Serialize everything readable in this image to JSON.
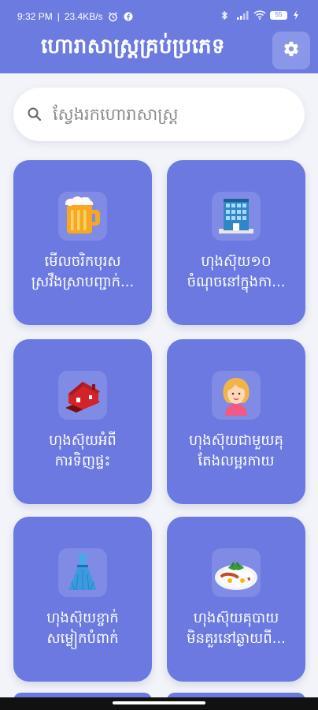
{
  "status_bar": {
    "time": "9:32 PM",
    "net_speed": "23.4KB/s",
    "battery": "55"
  },
  "header": {
    "title": "ហោរាសាស្ត្រគ្រប់ប្រភេទ",
    "settings_icon": "gear-icon"
  },
  "search": {
    "placeholder": "ស្វែងរកហោរាសាស្ត្រ",
    "value": "",
    "icon": "search-icon"
  },
  "colors": {
    "header": "#6c7be0",
    "card": "#6b79e0",
    "background": "#f3f4f9"
  },
  "cards": [
    {
      "label": "មើលចរិកបុរស\nស្រវឹងស្រាបញ្ជាក់...",
      "icon": "beer-mug-icon"
    },
    {
      "label": "ហុងស៊ុយ១០\nចំណុចនៅក្នុងកា...",
      "icon": "office-building-icon"
    },
    {
      "label": "ហុងស៊ុយអំពី\nការទិញផ្ទះ",
      "icon": "red-house-icon"
    },
    {
      "label": "ហុងស៊ុយជាមួយគុ\nតែងលម្អរកាយ",
      "icon": "woman-avatar-icon"
    },
    {
      "label": "ហុងស៊ុយខ្ចាក់\nសម្លៀកបំពាក់",
      "icon": "blue-dress-icon"
    },
    {
      "label": "ហុងស៊ុយគុបាយ\nមិនគួរនៅឆ្ងាយពី...",
      "icon": "food-plate-icon"
    }
  ]
}
